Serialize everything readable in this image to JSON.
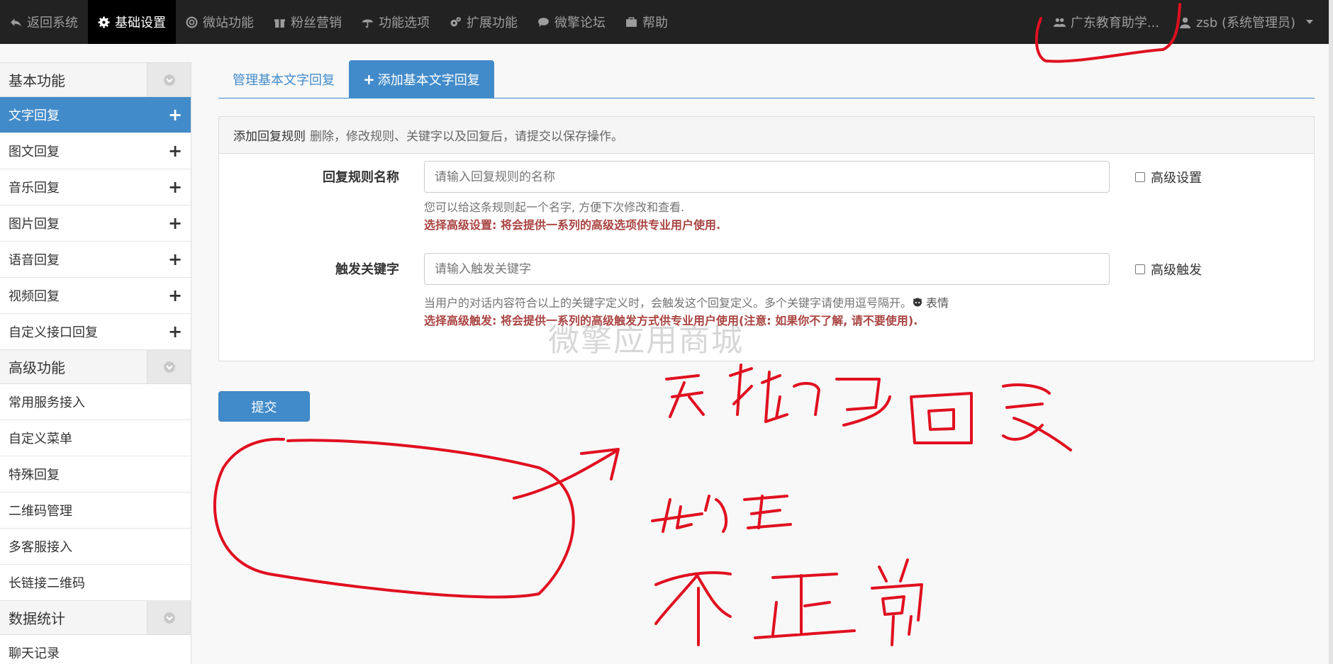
{
  "topbar": {
    "items": [
      {
        "label": "返回系统",
        "icon": "reply-icon"
      },
      {
        "label": "基础设置",
        "icon": "gear-icon"
      },
      {
        "label": "微站功能",
        "icon": "lifebuoy-icon"
      },
      {
        "label": "粉丝营销",
        "icon": "gift-icon"
      },
      {
        "label": "功能选项",
        "icon": "umbrella-icon"
      },
      {
        "label": "扩展功能",
        "icon": "gears-icon"
      },
      {
        "label": "微擎论坛",
        "icon": "comment-icon"
      },
      {
        "label": "帮助",
        "icon": "briefcase-icon"
      }
    ],
    "account": "广东教育助学...",
    "user": "zsb (系统管理员)"
  },
  "sidebar": {
    "groups": [
      {
        "title": "基本功能",
        "items": [
          "文字回复",
          "图文回复",
          "音乐回复",
          "图片回复",
          "语音回复",
          "视频回复",
          "自定义接口回复"
        ]
      },
      {
        "title": "高级功能",
        "items": [
          "常用服务接入",
          "自定义菜单",
          "特殊回复",
          "二维码管理",
          "多客服接入",
          "长链接二维码"
        ]
      },
      {
        "title": "数据统计",
        "items": [
          "聊天记录"
        ]
      }
    ]
  },
  "tabs": {
    "manage": "管理基本文字回复",
    "add": "添加基本文字回复"
  },
  "panel": {
    "title": "添加回复规则",
    "subtitle": "删除，修改规则、关键字以及回复后，请提交以保存操作。"
  },
  "form": {
    "rule_name": {
      "label": "回复规则名称",
      "placeholder": "请输入回复规则的名称",
      "checkbox": "高级设置",
      "help": "您可以给这条规则起一个名字, 方便下次修改和查看.",
      "warn": "选择高级设置: 将会提供一系列的高级选项供专业用户使用."
    },
    "keyword": {
      "label": "触发关键字",
      "placeholder": "请输入触发关键字",
      "checkbox": "高级触发",
      "help": "当用户的对话内容符合以上的关键字定义时，会触发这个回复定义。多个关键字请使用逗号隔开。",
      "emoji_link": "表情",
      "warn": "选择高级触发: 将会提供一系列的高级触发方式供专业用户使用(注意: 如果你不了解, 请不要使用)."
    },
    "submit": "提交"
  },
  "watermark": "微擎应用商城",
  "colors": {
    "navbar": "#222222",
    "primary": "#428bca",
    "warning_text": "#a94442",
    "annotation": "#e01020"
  }
}
